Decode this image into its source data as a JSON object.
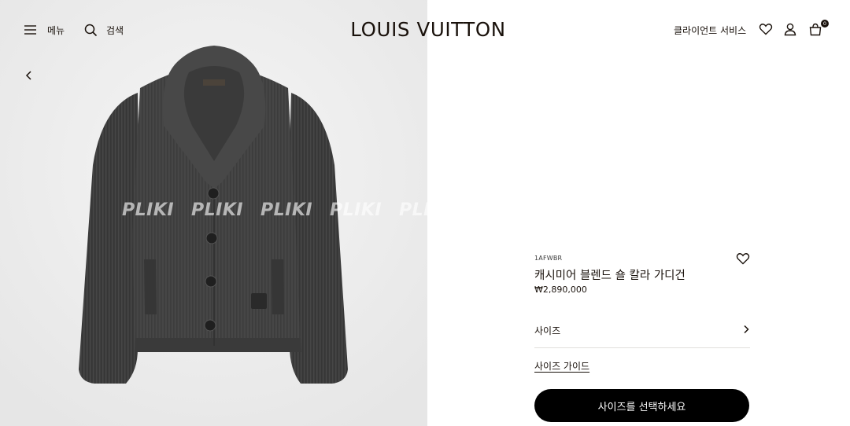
{
  "header": {
    "menu_label": "메뉴",
    "search_label": "검색",
    "logo": "LOUIS VUITTON",
    "client_service": "클라이언트 서비스",
    "cart_count": "0",
    "icons": [
      "menu-icon",
      "search-icon",
      "heart-icon",
      "user-icon",
      "bag-icon"
    ]
  },
  "gallery": {
    "prev_icon": "chevron-left-icon",
    "watermark": [
      "PLIKI",
      "PLIKI",
      "PLIKI",
      "PLIKI",
      "PLIKI"
    ],
    "garment_color": "#3e3e3e"
  },
  "product": {
    "sku": "1AFWBR",
    "name": "캐시미어 블렌드 숄 칼라 가디건",
    "price": "₩2,890,000",
    "size_label": "사이즈",
    "size_guide": "사이즈 가이드",
    "cta_label": "사이즈를 선택하세요"
  },
  "colors": {
    "text": "#19110b",
    "cta_bg": "#000000",
    "cta_text": "#ffffff",
    "divider": "#e1dfdc"
  }
}
